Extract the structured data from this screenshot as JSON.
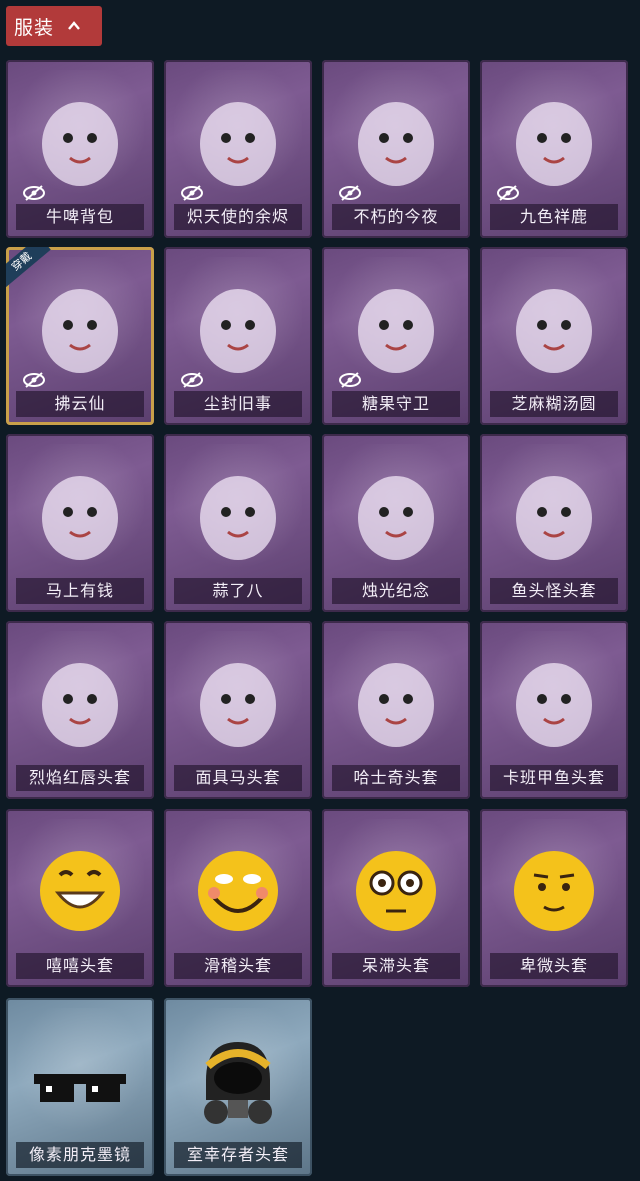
{
  "header": {
    "title": "服装"
  },
  "items": [
    {
      "label": "牛啤背包",
      "icon": "beer-cow-backpack-icon",
      "hidden": true
    },
    {
      "label": "炽天使的余烬",
      "icon": "angel-doll-icon",
      "hidden": true
    },
    {
      "label": "不朽的今夜",
      "icon": "cat-cup-icon",
      "hidden": true
    },
    {
      "label": "九色祥鹿",
      "icon": "deer-icon",
      "hidden": true
    },
    {
      "label": "拂云仙",
      "icon": "cloud-fairy-icon",
      "hidden": true,
      "badge": "穿戴"
    },
    {
      "label": "尘封旧事",
      "icon": "doll-charm-icon",
      "hidden": true
    },
    {
      "label": "糖果守卫",
      "icon": "pumpkin-charm-icon",
      "hidden": true
    },
    {
      "label": "芝麻糊汤圆",
      "icon": "dumpling-icon",
      "hidden": false
    },
    {
      "label": "马上有钱",
      "icon": "horse-hat-icon",
      "hidden": false
    },
    {
      "label": "蒜了八",
      "icon": "garlic-icon",
      "hidden": false
    },
    {
      "label": "烛光纪念",
      "icon": "candle-icon",
      "hidden": false
    },
    {
      "label": "鱼头怪头套",
      "icon": "fish-head-mask-icon",
      "hidden": false
    },
    {
      "label": "烈焰红唇头套",
      "icon": "yellow-mask-icon",
      "hidden": false
    },
    {
      "label": "面具马头套",
      "icon": "horse-mask-icon",
      "hidden": false
    },
    {
      "label": "哈士奇头套",
      "icon": "husky-mask-icon",
      "hidden": false
    },
    {
      "label": "卡班甲鱼头套",
      "icon": "fish-mask-icon",
      "hidden": false
    },
    {
      "label": "嘻嘻头套",
      "icon": "grin-emoji-icon",
      "hidden": false
    },
    {
      "label": "滑稽头套",
      "icon": "smile-emoji-icon",
      "hidden": false
    },
    {
      "label": "呆滞头套",
      "icon": "stare-emoji-icon",
      "hidden": false
    },
    {
      "label": "卑微头套",
      "icon": "shy-emoji-icon",
      "hidden": false
    },
    {
      "label": "像素朋克墨镜",
      "icon": "pixel-sunglasses-icon",
      "hidden": false,
      "rarity": "blue"
    },
    {
      "label": "室幸存者头套",
      "icon": "gas-mask-helmet-icon",
      "hidden": false,
      "rarity": "blue"
    }
  ]
}
